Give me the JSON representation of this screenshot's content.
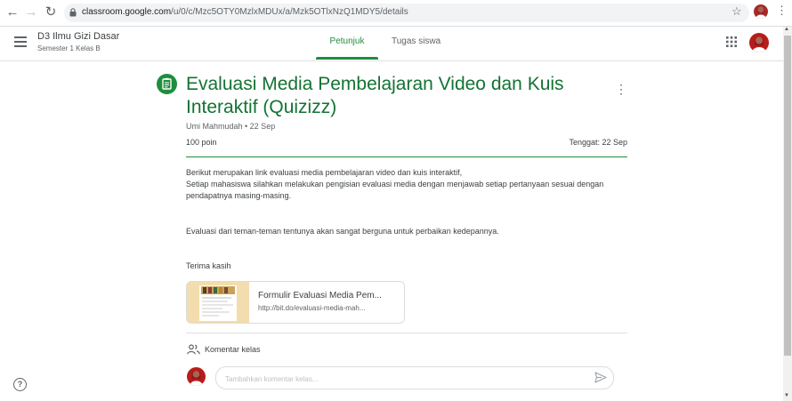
{
  "browser": {
    "url_host": "classroom.google.com",
    "url_path": "/u/0/c/Mzc5OTY0MzlxMDUx/a/Mzk5OTlxNzQ1MDY5/details"
  },
  "header": {
    "class_name": "D3 Ilmu Gizi Dasar",
    "class_section": "Semester 1 Kelas B",
    "tabs": [
      {
        "label": "Petunjuk",
        "active": true
      },
      {
        "label": "Tugas siswa",
        "active": false
      }
    ]
  },
  "assignment": {
    "title": "Evaluasi Media Pembelajaran Video dan Kuis Interaktif (Quizizz)",
    "meta": "Umi Mahmudah • 22 Sep",
    "points": "100 poin",
    "due": "Tenggat: 22 Sep",
    "description": [
      "Berikut merupakan link evaluasi media pembelajaran video dan kuis interaktif,",
      "Setiap mahasiswa silahkan melakukan pengisian evaluasi media dengan menjawab setiap pertanyaan sesuai dengan pendapatnya masing-masing.",
      "Evaluasi dari teman-teman tentunya akan sangat berguna untuk perbaikan kedepannya.",
      "Terima kasih"
    ],
    "attachment": {
      "title": "Formulir Evaluasi Media Pem...",
      "url": "http://bit.do/evaluasi-media-mah..."
    }
  },
  "comments": {
    "label": "Komentar kelas",
    "placeholder": "Tambahkan komentar kelas..."
  },
  "colors": {
    "accent": "#1e8e3e",
    "title": "#137333"
  },
  "icons": [
    "back-icon",
    "forward-icon",
    "reload-icon",
    "lock-icon",
    "star-icon",
    "menu-icon",
    "apps-icon",
    "assignment-icon",
    "more-vert-icon",
    "people-icon",
    "send-icon",
    "help-icon"
  ]
}
